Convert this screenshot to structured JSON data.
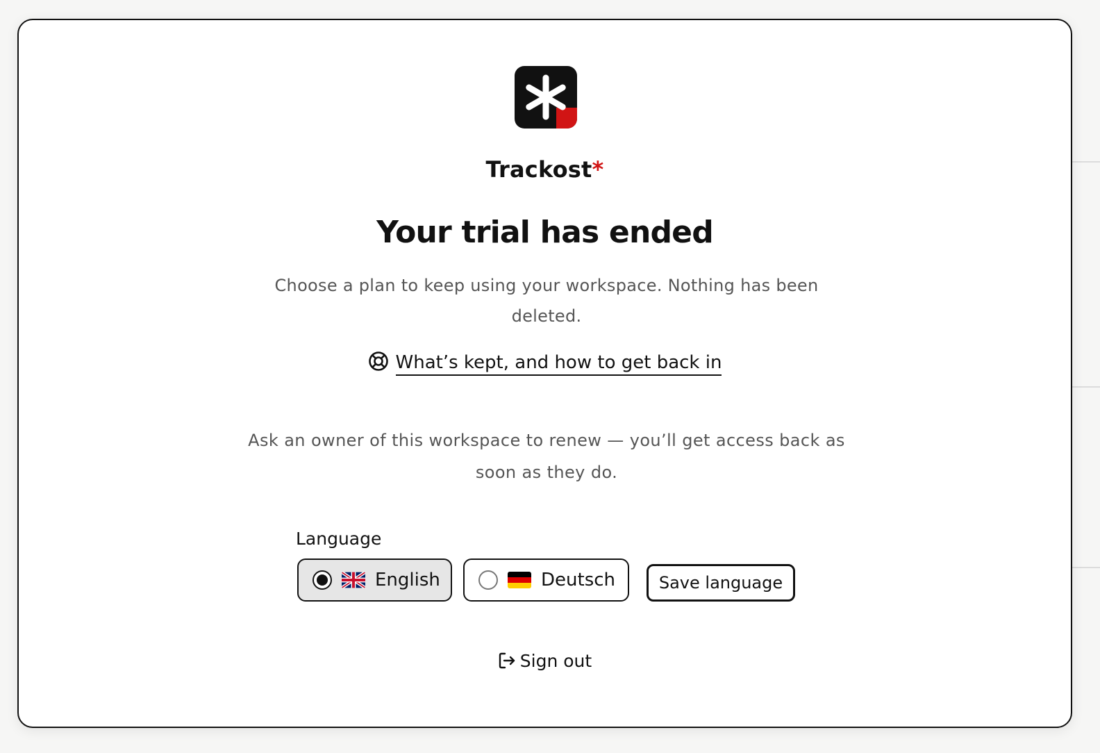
{
  "app": {
    "name": "Trackost",
    "name_mark": "*",
    "logo_icon": "asterisk-logo-icon",
    "brand_accent": "#d11414"
  },
  "dialog": {
    "title": "Your trial has ended",
    "subtitle": "Choose a plan to keep using your workspace. Nothing has been deleted.",
    "help_link": "What’s kept, and how to get back in",
    "help_icon": "lifebuoy-icon",
    "notice": "Ask an owner of this workspace to renew — you’ll get access back as soon as they do."
  },
  "language": {
    "label": "Language",
    "options": [
      {
        "label": "English",
        "flag": "uk-flag-icon",
        "selected": true
      },
      {
        "label": "Deutsch",
        "flag": "germany-flag-icon",
        "selected": false
      }
    ],
    "save_label": "Save language"
  },
  "signout": {
    "label": "Sign out",
    "icon": "sign-out-icon"
  }
}
